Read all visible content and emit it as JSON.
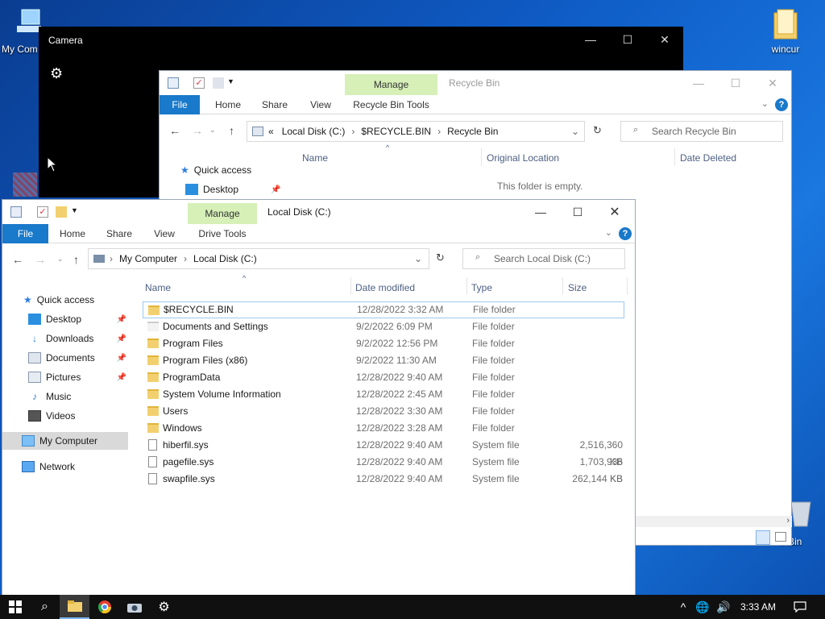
{
  "desktop": {
    "my_computer_label": "My Com",
    "wincur_label": "wincur",
    "recycle_label": "e Bin"
  },
  "camera": {
    "title": "Camera",
    "minimize": "—",
    "maximize": "☐",
    "close": "✕",
    "gear": "⚙"
  },
  "recycle": {
    "title": "Recycle Bin",
    "manage": "Manage",
    "tools_tab": "Recycle Bin Tools",
    "tabs": [
      "File",
      "Home",
      "Share",
      "View"
    ],
    "address": [
      "«",
      "Local Disk (C:)",
      "$RECYCLE.BIN",
      "Recycle Bin"
    ],
    "search_placeholder": "Search Recycle Bin",
    "columns": [
      "Name",
      "Original Location",
      "Date Deleted"
    ],
    "empty_message": "This folder is empty.",
    "nav": [
      {
        "label": "Quick access"
      },
      {
        "label": "Desktop"
      }
    ]
  },
  "local": {
    "title": "Local Disk (C:)",
    "manage": "Manage",
    "tools_tab": "Drive Tools",
    "tabs": [
      "File",
      "Home",
      "Share",
      "View"
    ],
    "address": [
      "My Computer",
      "Local Disk (C:)"
    ],
    "search_placeholder": "Search Local Disk (C:)",
    "columns": [
      "Name",
      "Date modified",
      "Type",
      "Size"
    ],
    "nav": [
      {
        "label": "Quick access"
      },
      {
        "label": "Desktop"
      },
      {
        "label": "Downloads"
      },
      {
        "label": "Documents"
      },
      {
        "label": "Pictures"
      },
      {
        "label": "Music"
      },
      {
        "label": "Videos"
      },
      {
        "label": "My Computer"
      },
      {
        "label": "Network"
      }
    ],
    "files": [
      {
        "name": "$RECYCLE.BIN",
        "date": "12/28/2022 3:32 AM",
        "type": "File folder",
        "size": "",
        "kind": "folder"
      },
      {
        "name": "Documents and Settings",
        "date": "9/2/2022 6:09 PM",
        "type": "File folder",
        "size": "",
        "kind": "link"
      },
      {
        "name": "Program Files",
        "date": "9/2/2022 12:56 PM",
        "type": "File folder",
        "size": "",
        "kind": "folder"
      },
      {
        "name": "Program Files (x86)",
        "date": "9/2/2022 11:30 AM",
        "type": "File folder",
        "size": "",
        "kind": "folder"
      },
      {
        "name": "ProgramData",
        "date": "12/28/2022 9:40 AM",
        "type": "File folder",
        "size": "",
        "kind": "folder"
      },
      {
        "name": "System Volume Information",
        "date": "12/28/2022 2:45 AM",
        "type": "File folder",
        "size": "",
        "kind": "folder"
      },
      {
        "name": "Users",
        "date": "12/28/2022 3:30 AM",
        "type": "File folder",
        "size": "",
        "kind": "folder"
      },
      {
        "name": "Windows",
        "date": "12/28/2022 3:28 AM",
        "type": "File folder",
        "size": "",
        "kind": "folder"
      },
      {
        "name": "hiberfil.sys",
        "date": "12/28/2022 9:40 AM",
        "type": "System file",
        "size": "2,516,360 KB",
        "kind": "file"
      },
      {
        "name": "pagefile.sys",
        "date": "12/28/2022 9:40 AM",
        "type": "System file",
        "size": "1,703,936 KB",
        "kind": "file"
      },
      {
        "name": "swapfile.sys",
        "date": "12/28/2022 9:40 AM",
        "type": "System file",
        "size": "262,144 KB",
        "kind": "file"
      }
    ]
  },
  "taskbar": {
    "time": "3:33 AM"
  }
}
